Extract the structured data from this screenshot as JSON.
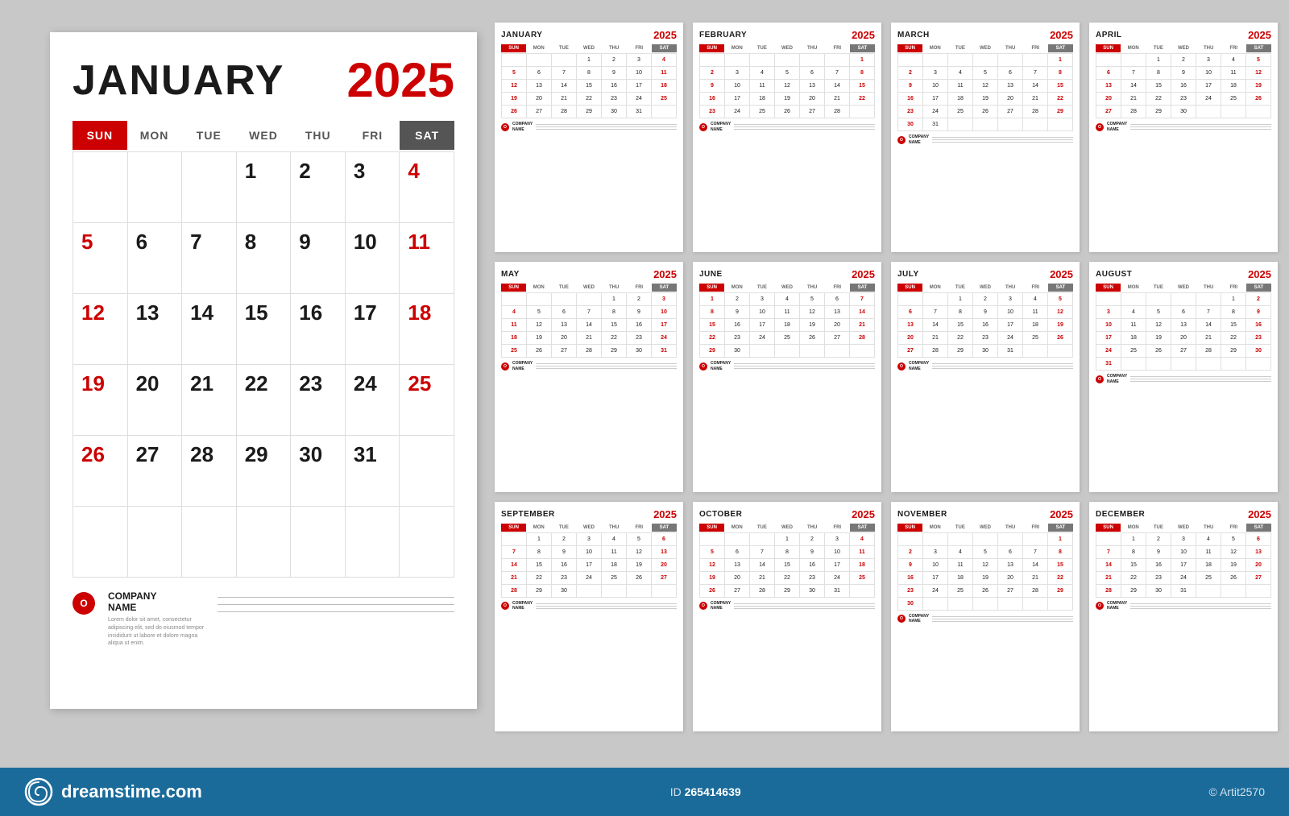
{
  "main_calendar": {
    "month": "JANUARY",
    "year": "2025",
    "day_labels": [
      "SUN",
      "MON",
      "TUE",
      "WED",
      "THU",
      "FRI",
      "SAT"
    ],
    "weeks": [
      [
        {
          "n": "",
          "type": "empty"
        },
        {
          "n": "",
          "type": "empty"
        },
        {
          "n": "",
          "type": "empty"
        },
        {
          "n": "1",
          "type": ""
        },
        {
          "n": "2",
          "type": ""
        },
        {
          "n": "3",
          "type": ""
        },
        {
          "n": "4",
          "type": "sat"
        }
      ],
      [
        {
          "n": "5",
          "type": "sun"
        },
        {
          "n": "6",
          "type": ""
        },
        {
          "n": "7",
          "type": ""
        },
        {
          "n": "8",
          "type": ""
        },
        {
          "n": "9",
          "type": ""
        },
        {
          "n": "10",
          "type": ""
        },
        {
          "n": "11",
          "type": "sat"
        }
      ],
      [
        {
          "n": "12",
          "type": "sun"
        },
        {
          "n": "13",
          "type": ""
        },
        {
          "n": "14",
          "type": ""
        },
        {
          "n": "15",
          "type": ""
        },
        {
          "n": "16",
          "type": ""
        },
        {
          "n": "17",
          "type": ""
        },
        {
          "n": "18",
          "type": "sat"
        }
      ],
      [
        {
          "n": "19",
          "type": "sun"
        },
        {
          "n": "20",
          "type": ""
        },
        {
          "n": "21",
          "type": ""
        },
        {
          "n": "22",
          "type": ""
        },
        {
          "n": "23",
          "type": ""
        },
        {
          "n": "24",
          "type": ""
        },
        {
          "n": "25",
          "type": "sat"
        }
      ],
      [
        {
          "n": "26",
          "type": "sun"
        },
        {
          "n": "27",
          "type": ""
        },
        {
          "n": "28",
          "type": ""
        },
        {
          "n": "29",
          "type": ""
        },
        {
          "n": "30",
          "type": ""
        },
        {
          "n": "31",
          "type": ""
        },
        {
          "n": "",
          "type": "empty"
        }
      ],
      [
        {
          "n": "",
          "type": "empty"
        },
        {
          "n": "",
          "type": "empty"
        },
        {
          "n": "",
          "type": "empty"
        },
        {
          "n": "",
          "type": "empty"
        },
        {
          "n": "",
          "type": "empty"
        },
        {
          "n": "",
          "type": "empty"
        },
        {
          "n": "",
          "type": "empty"
        }
      ]
    ],
    "company": {
      "logo_letter": "O",
      "name": "COMPANY\nNAME",
      "desc": "Lorem dolor sit amet, consectetur adipiscing elit, sed do eiusmod tempor incididunt ut labore et dolore magna aliqua ut enim."
    }
  },
  "small_calendars": [
    {
      "month": "JANUARY",
      "year": "2025",
      "weeks": [
        [
          "",
          "",
          "",
          "1",
          "2",
          "3",
          "4"
        ],
        [
          "5",
          "6",
          "7",
          "8",
          "9",
          "10",
          "11"
        ],
        [
          "12",
          "13",
          "14",
          "15",
          "16",
          "17",
          "18"
        ],
        [
          "19",
          "20",
          "21",
          "22",
          "23",
          "24",
          "25"
        ],
        [
          "26",
          "27",
          "28",
          "29",
          "30",
          "31",
          ""
        ]
      ]
    },
    {
      "month": "FEBRUARY",
      "year": "2025",
      "weeks": [
        [
          "",
          "",
          "",
          "",
          "",
          "",
          "1"
        ],
        [
          "2",
          "3",
          "4",
          "5",
          "6",
          "7",
          "8"
        ],
        [
          "9",
          "10",
          "11",
          "12",
          "13",
          "14",
          "15"
        ],
        [
          "16",
          "17",
          "18",
          "19",
          "20",
          "21",
          "22"
        ],
        [
          "23",
          "24",
          "25",
          "26",
          "27",
          "28",
          ""
        ]
      ]
    },
    {
      "month": "MARCH",
      "year": "2025",
      "weeks": [
        [
          "",
          "",
          "",
          "",
          "",
          "",
          "1"
        ],
        [
          "2",
          "3",
          "4",
          "5",
          "6",
          "7",
          "8"
        ],
        [
          "9",
          "10",
          "11",
          "12",
          "13",
          "14",
          "15"
        ],
        [
          "16",
          "17",
          "18",
          "19",
          "20",
          "21",
          "22"
        ],
        [
          "23",
          "24",
          "25",
          "26",
          "27",
          "28",
          "29"
        ],
        [
          "30",
          "31",
          "",
          "",
          "",
          "",
          ""
        ]
      ]
    },
    {
      "month": "APRIL",
      "year": "2025",
      "weeks": [
        [
          "",
          "",
          "1",
          "2",
          "3",
          "4",
          "5"
        ],
        [
          "6",
          "7",
          "8",
          "9",
          "10",
          "11",
          "12"
        ],
        [
          "13",
          "14",
          "15",
          "16",
          "17",
          "18",
          "19"
        ],
        [
          "20",
          "21",
          "22",
          "23",
          "24",
          "25",
          "26"
        ],
        [
          "27",
          "28",
          "29",
          "30",
          "",
          "",
          ""
        ]
      ]
    },
    {
      "month": "MAY",
      "year": "2025",
      "weeks": [
        [
          "",
          "",
          "",
          "",
          "1",
          "2",
          "3"
        ],
        [
          "4",
          "5",
          "6",
          "7",
          "8",
          "9",
          "10"
        ],
        [
          "11",
          "12",
          "13",
          "14",
          "15",
          "16",
          "17"
        ],
        [
          "18",
          "19",
          "20",
          "21",
          "22",
          "23",
          "24"
        ],
        [
          "25",
          "26",
          "27",
          "28",
          "29",
          "30",
          "31"
        ]
      ]
    },
    {
      "month": "JUNE",
      "year": "2025",
      "weeks": [
        [
          "1",
          "2",
          "3",
          "4",
          "5",
          "6",
          "7"
        ],
        [
          "8",
          "9",
          "10",
          "11",
          "12",
          "13",
          "14"
        ],
        [
          "15",
          "16",
          "17",
          "18",
          "19",
          "20",
          "21"
        ],
        [
          "22",
          "23",
          "24",
          "25",
          "26",
          "27",
          "28"
        ],
        [
          "29",
          "30",
          "",
          "",
          "",
          "",
          ""
        ]
      ]
    },
    {
      "month": "JULY",
      "year": "2025",
      "weeks": [
        [
          "",
          "",
          "1",
          "2",
          "3",
          "4",
          "5"
        ],
        [
          "6",
          "7",
          "8",
          "9",
          "10",
          "11",
          "12"
        ],
        [
          "13",
          "14",
          "15",
          "16",
          "17",
          "18",
          "19"
        ],
        [
          "20",
          "21",
          "22",
          "23",
          "24",
          "25",
          "26"
        ],
        [
          "27",
          "28",
          "29",
          "30",
          "31",
          "",
          ""
        ]
      ]
    },
    {
      "month": "AUGUST",
      "year": "2025",
      "weeks": [
        [
          "",
          "",
          "",
          "",
          "",
          "1",
          "2"
        ],
        [
          "3",
          "4",
          "5",
          "6",
          "7",
          "8",
          "9"
        ],
        [
          "10",
          "11",
          "12",
          "13",
          "14",
          "15",
          "16"
        ],
        [
          "17",
          "18",
          "19",
          "20",
          "21",
          "22",
          "23"
        ],
        [
          "24",
          "25",
          "26",
          "27",
          "28",
          "29",
          "30"
        ],
        [
          "31",
          "",
          "",
          "",
          "",
          "",
          ""
        ]
      ]
    },
    {
      "month": "SEPTEMBER",
      "year": "2025",
      "weeks": [
        [
          "",
          "1",
          "2",
          "3",
          "4",
          "5",
          "6"
        ],
        [
          "7",
          "8",
          "9",
          "10",
          "11",
          "12",
          "13"
        ],
        [
          "14",
          "15",
          "16",
          "17",
          "18",
          "19",
          "20"
        ],
        [
          "21",
          "22",
          "23",
          "24",
          "25",
          "26",
          "27"
        ],
        [
          "28",
          "29",
          "30",
          "",
          "",
          "",
          ""
        ]
      ]
    },
    {
      "month": "OCTOBER",
      "year": "2025",
      "weeks": [
        [
          "",
          "",
          "",
          "1",
          "2",
          "3",
          "4"
        ],
        [
          "5",
          "6",
          "7",
          "8",
          "9",
          "10",
          "11"
        ],
        [
          "12",
          "13",
          "14",
          "15",
          "16",
          "17",
          "18"
        ],
        [
          "19",
          "20",
          "21",
          "22",
          "23",
          "24",
          "25"
        ],
        [
          "26",
          "27",
          "28",
          "29",
          "30",
          "31",
          ""
        ]
      ]
    },
    {
      "month": "NOVEMBER",
      "year": "2025",
      "weeks": [
        [
          "",
          "",
          "",
          "",
          "",
          "",
          "1"
        ],
        [
          "2",
          "3",
          "4",
          "5",
          "6",
          "7",
          "8"
        ],
        [
          "9",
          "10",
          "11",
          "12",
          "13",
          "14",
          "15"
        ],
        [
          "16",
          "17",
          "18",
          "19",
          "20",
          "21",
          "22"
        ],
        [
          "23",
          "24",
          "25",
          "26",
          "27",
          "28",
          "29"
        ],
        [
          "30",
          "",
          "",
          "",
          "",
          "",
          ""
        ]
      ]
    },
    {
      "month": "DECEMBER",
      "year": "2025",
      "weeks": [
        [
          "",
          "1",
          "2",
          "3",
          "4",
          "5",
          "6"
        ],
        [
          "7",
          "8",
          "9",
          "10",
          "11",
          "12",
          "13"
        ],
        [
          "14",
          "15",
          "16",
          "17",
          "18",
          "19",
          "20"
        ],
        [
          "21",
          "22",
          "23",
          "24",
          "25",
          "26",
          "27"
        ],
        [
          "28",
          "29",
          "30",
          "31",
          "",
          "",
          ""
        ]
      ]
    }
  ],
  "day_labels": [
    "SUN",
    "MON",
    "TUE",
    "WED",
    "THU",
    "FRI",
    "SAT"
  ],
  "footer": {
    "dreamstime_text": "dreamstime.com",
    "stock_id_label": "ID",
    "stock_id": "265414639",
    "author_label": "© Artit2570",
    "logo_letter": "O",
    "company_name": "COMPANY\nNAME"
  }
}
